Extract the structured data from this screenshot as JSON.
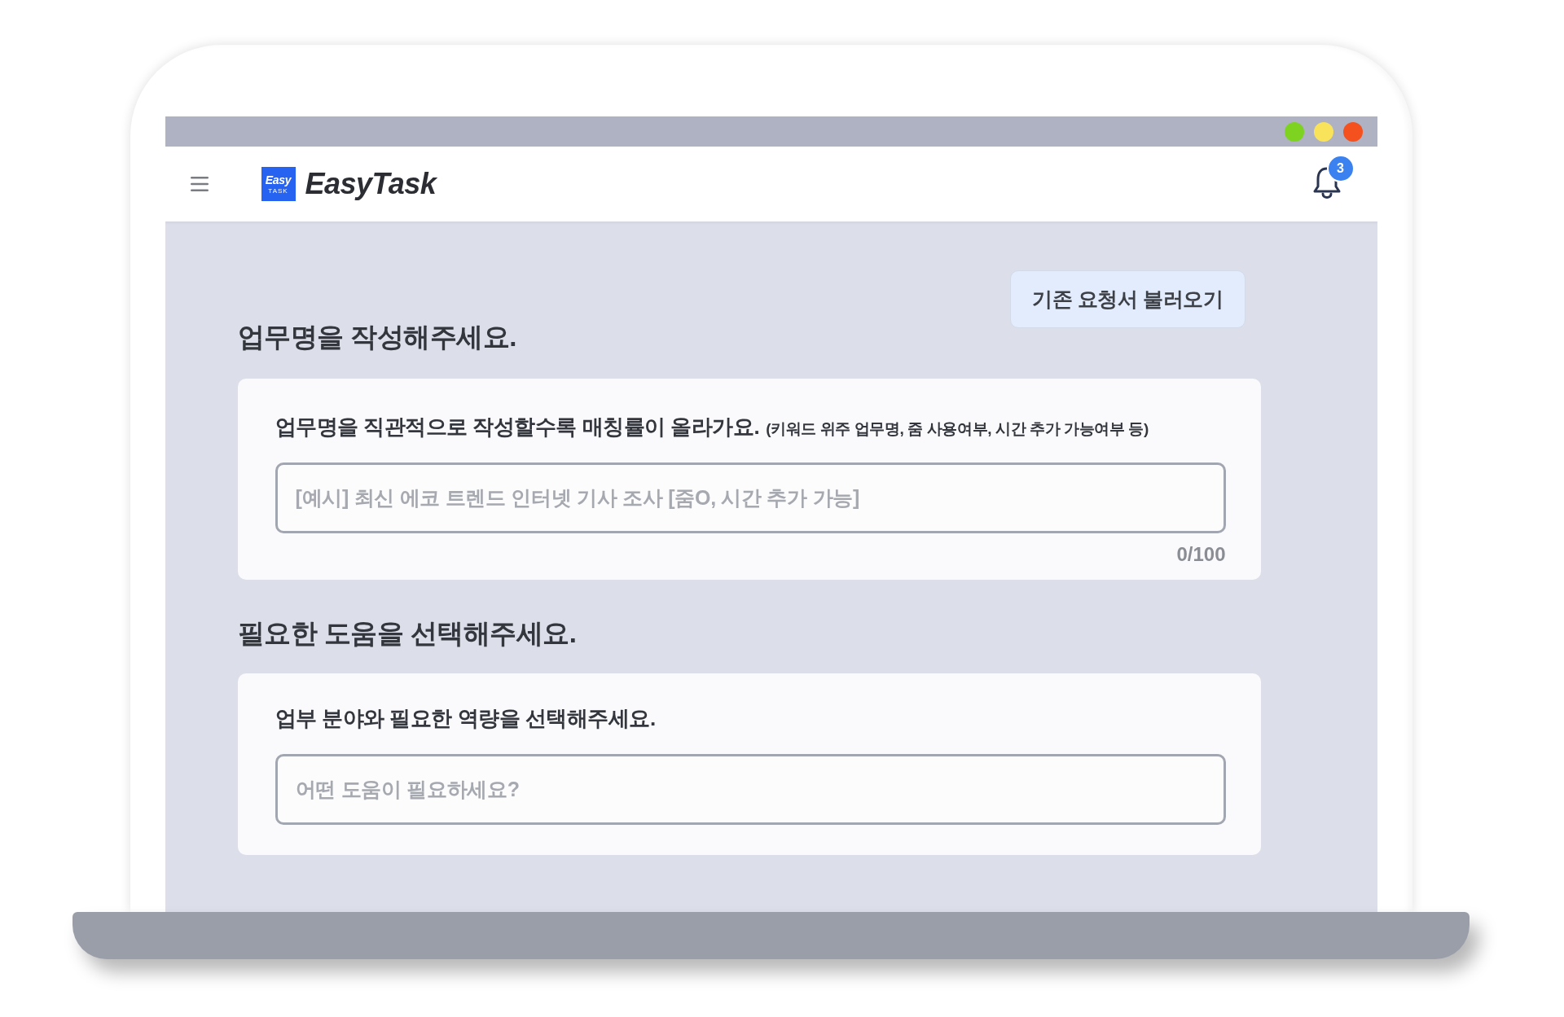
{
  "window": {
    "controls": [
      {
        "color": "#7ed321"
      },
      {
        "color": "#f8e35b"
      },
      {
        "color": "#f4511e"
      }
    ]
  },
  "header": {
    "logo": {
      "mark_word": "Easy",
      "mark_tagline": "TASK",
      "name": "EasyTask"
    },
    "notifications": {
      "count": "3"
    }
  },
  "load_button": "기존 요청서 불러오기",
  "sections": [
    {
      "heading": "업무명을 작성해주세요.",
      "label": "업무명을 직관적으로 작성할수록 매칭률이 올라가요.",
      "hint": "(키워드 위주 업무명, 줌 사용여부, 시간 추가 가능여부 등)",
      "input": {
        "placeholder": "[예시] 최신 에코 트렌드 인터넷 기사 조사 [줌O, 시간 추가 가능]",
        "counter": "0/100"
      }
    },
    {
      "heading": "필요한 도움을 선택해주세요.",
      "label": "업부 분야와 필요한 역량을 선택해주세요.",
      "input": {
        "placeholder": "어떤 도움이 필요하세요?"
      }
    }
  ]
}
